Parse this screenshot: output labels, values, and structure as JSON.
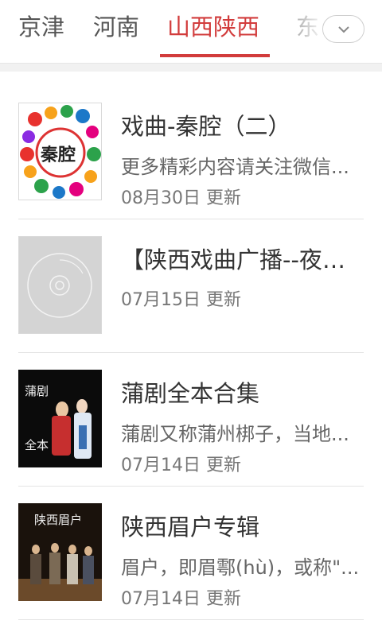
{
  "colors": {
    "accent": "#d23c3c",
    "text": "#333333",
    "subtext": "#666666"
  },
  "tabs": [
    {
      "label": "京津"
    },
    {
      "label": "河南"
    },
    {
      "label": "山西陕西",
      "selected": true
    },
    {
      "label": "东"
    }
  ],
  "more_icon": "chevron-down-icon",
  "list": [
    {
      "title": "戏曲-秦腔（二）",
      "desc": "更多精彩内容请关注微信...",
      "date": "08月30日 更新",
      "thumb_text": "秦腔"
    },
    {
      "title": "【陕西戏曲广播--夜话...",
      "desc": "",
      "date": "07月15日 更新",
      "thumb_icon": "disc-placeholder-icon"
    },
    {
      "title": "蒲剧全本合集",
      "desc": "蒲剧又称蒲州梆子，当地...",
      "date": "07月14日 更新",
      "thumb_text_top": "蒲剧",
      "thumb_text_bottom": "全本"
    },
    {
      "title": "陕西眉户专辑",
      "desc": "眉户，即眉鄠(hù)，或称\"...",
      "date": "07月14日 更新",
      "thumb_text": "陕西眉户"
    }
  ]
}
